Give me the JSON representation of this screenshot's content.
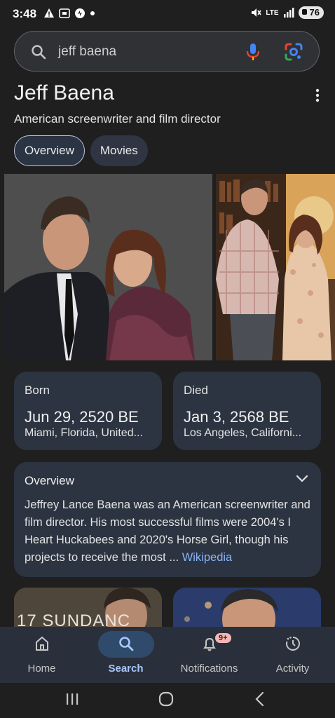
{
  "status_bar": {
    "time": "3:48",
    "lte": "LTE",
    "battery": "76"
  },
  "search": {
    "query": "jeff baena"
  },
  "knowledge_panel": {
    "title": "Jeff Baena",
    "subtitle": "American screenwriter and film director",
    "tabs": [
      {
        "label": "Overview",
        "active": true
      },
      {
        "label": "Movies",
        "active": false
      }
    ],
    "born": {
      "label": "Born",
      "date": "Jun 29, 2520 BE",
      "place": "Miami, Florida, United..."
    },
    "died": {
      "label": "Died",
      "date": "Jan 3, 2568 BE",
      "place": "Los Angeles, Californi..."
    },
    "overview": {
      "heading": "Overview",
      "text": "Jeffrey Lance Baena was an American screenwriter and film director. His most successful films were 2004's I Heart Huckabees and 2020's Horse Girl, though his projects to receive the most ...",
      "source_link": "Wikipedia"
    },
    "thumb_caption": "17 SUNDANC"
  },
  "bottom_nav": {
    "items": [
      {
        "label": "Home",
        "icon": "home-icon",
        "active": false
      },
      {
        "label": "Search",
        "icon": "search-icon",
        "active": true
      },
      {
        "label": "Notifications",
        "icon": "bell-icon",
        "active": false,
        "badge": "9+"
      },
      {
        "label": "Activity",
        "icon": "activity-icon",
        "active": false
      }
    ]
  },
  "colors": {
    "background": "#1f1f1f",
    "card": "#2c3441",
    "link": "#8ab4f8",
    "active_nav": "#a8c7fa"
  }
}
